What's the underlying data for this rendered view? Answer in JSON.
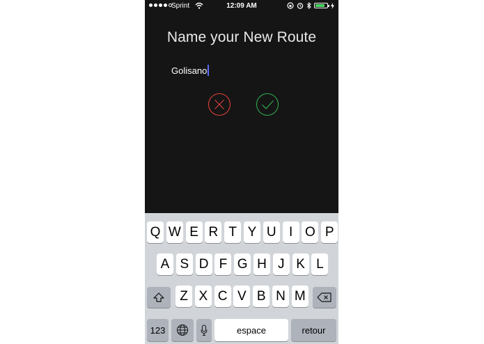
{
  "status": {
    "carrier": "Sprint",
    "time": "12:09 AM",
    "signal_bars": 5,
    "signal_filled": 4,
    "battery_level": 0.8
  },
  "screen": {
    "title": "Name your New Route",
    "route_name_value": "Golisano",
    "cancel_color": "#e0403a",
    "confirm_color": "#2fa84f"
  },
  "keyboard": {
    "row1": [
      "Q",
      "W",
      "E",
      "R",
      "T",
      "Y",
      "U",
      "I",
      "O",
      "P"
    ],
    "row2": [
      "A",
      "S",
      "D",
      "F",
      "G",
      "H",
      "J",
      "K",
      "L"
    ],
    "row3": [
      "Z",
      "X",
      "C",
      "V",
      "B",
      "N",
      "M"
    ],
    "numbers_label": "123",
    "space_label": "espace",
    "return_label": "retour"
  }
}
